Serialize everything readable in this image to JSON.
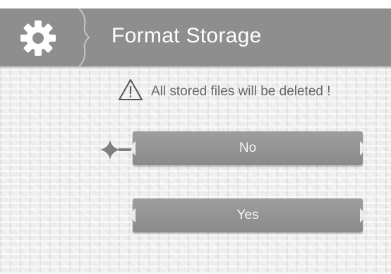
{
  "header": {
    "title": "Format Storage",
    "icon": "gear-icon",
    "background_color": "#8e8e8e"
  },
  "dialog": {
    "warning_icon": "warning-triangle-icon",
    "warning_text": "All stored files will be deleted !",
    "buttons": [
      {
        "label": "No",
        "selected": true
      },
      {
        "label": "Yes",
        "selected": false
      }
    ],
    "selection_marker_icon": "sparkle-pointer-icon"
  }
}
